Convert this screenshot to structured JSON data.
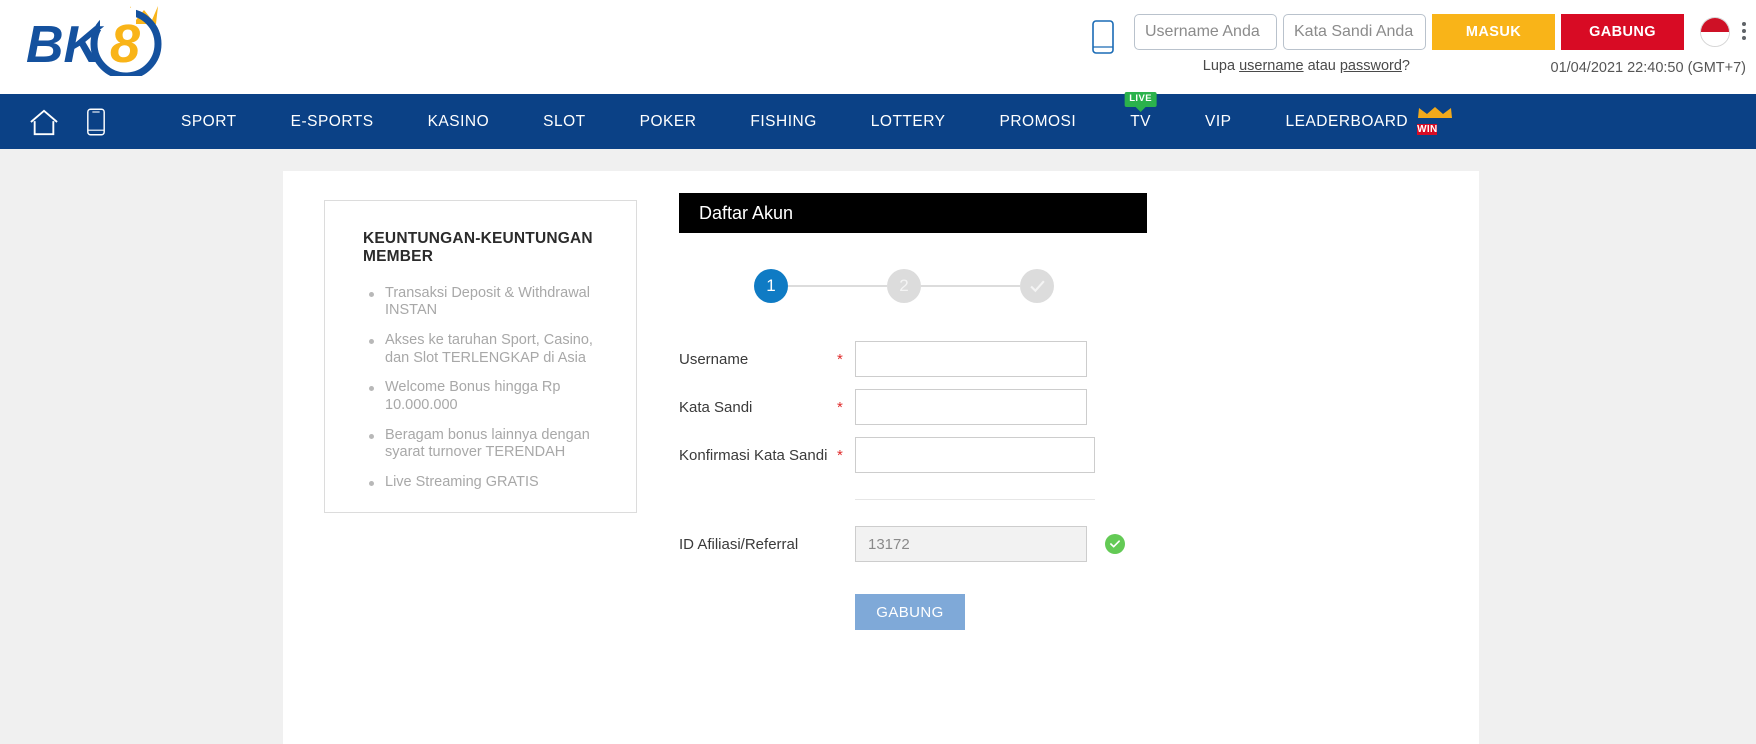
{
  "brand": {
    "logo_text": "BK8",
    "accent_yellow": "#f9b418",
    "accent_blue": "#0b4186",
    "accent_red": "#d80b24"
  },
  "header": {
    "mobile_icon": "mobile-phone-icon",
    "username_placeholder": "Username Anda",
    "username_value": "",
    "password_placeholder": "Kata Sandi Anda",
    "password_value": "",
    "login_button": "MASUK",
    "register_button": "GABUNG",
    "forgot_prefix": "Lupa ",
    "forgot_username_link": "username",
    "forgot_middle": " atau ",
    "forgot_password_link": "password",
    "forgot_suffix": "?",
    "timestamp": "01/04/2021 22:40:50 (GMT+7)",
    "flag": "indonesia-flag",
    "kebab_menu": "browser-menu-icon"
  },
  "nav": {
    "home_icon": "home-icon",
    "mobile_icon": "mobile-app-icon",
    "items": [
      {
        "label": "SPORT",
        "badge": null
      },
      {
        "label": "E-SPORTS",
        "badge": null
      },
      {
        "label": "KASINO",
        "badge": null
      },
      {
        "label": "SLOT",
        "badge": null
      },
      {
        "label": "POKER",
        "badge": null
      },
      {
        "label": "FISHING",
        "badge": null
      },
      {
        "label": "LOTTERY",
        "badge": null
      },
      {
        "label": "PROMOSI",
        "badge": null
      },
      {
        "label": "TV",
        "badge": "LIVE"
      },
      {
        "label": "VIP",
        "badge": null
      },
      {
        "label": "LEADERBOARD",
        "badge": "WIN"
      }
    ]
  },
  "benefits": {
    "title": "KEUNTUNGAN-KEUNTUNGAN MEMBER",
    "items": [
      "Transaksi Deposit & Withdrawal INSTAN",
      "Akses ke taruhan Sport, Casino, dan Slot TERLENGKAP di Asia",
      "Welcome Bonus hingga Rp 10.000.000",
      "Beragam bonus lainnya dengan syarat turnover TERENDAH",
      "Live Streaming GRATIS"
    ]
  },
  "form": {
    "header_title": "Daftar Akun",
    "steps": [
      {
        "label": "1",
        "state": "active"
      },
      {
        "label": "2",
        "state": "inactive"
      },
      {
        "label": "check",
        "state": "inactive"
      }
    ],
    "fields": [
      {
        "label": "Username",
        "required": "*",
        "value": "",
        "placeholder": ""
      },
      {
        "label": "Kata Sandi",
        "required": "*",
        "value": "",
        "placeholder": ""
      },
      {
        "label": "Konfirmasi Kata Sandi",
        "required": "*",
        "value": "",
        "placeholder": ""
      }
    ],
    "referral": {
      "label": "ID Afiliasi/Referral",
      "value": "13172",
      "status_icon": "check-circle-icon"
    },
    "submit_button": "GABUNG"
  }
}
